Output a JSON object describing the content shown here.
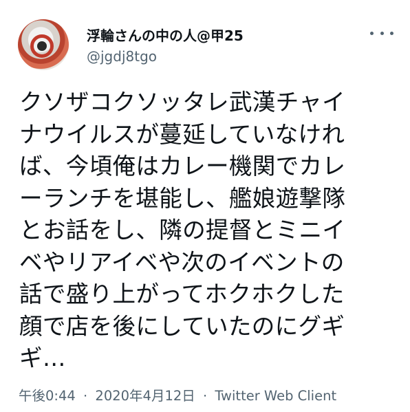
{
  "user": {
    "display_name": "浮輪さんの中の人@甲25",
    "handle": "@jgdj8tgo",
    "avatar_icon": "avatar-life-ring"
  },
  "menu": {
    "more_icon": "more-horizontal-icon"
  },
  "tweet": {
    "lines": [
      "クソザコクソッタレ武漢チャイ",
      "ナウイルスが蔓延していなけれ",
      "ば、今頃俺はカレー機関でカレ",
      "ーランチを堪能し、艦娘遊撃隊",
      "とお話をし、隣の提督とミニイ",
      "ベやリアイベや次のイベントの",
      "話で盛り上がってホクホクした",
      "顔で店を後にしていたのにグギ",
      "ギ…"
    ]
  },
  "meta": {
    "time": "午後0:44",
    "separator": "·",
    "date": "2020年4月12日",
    "client": "Twitter Web Client"
  },
  "colors": {
    "text": "#0f1419",
    "secondary": "#536471",
    "background": "#ffffff"
  }
}
